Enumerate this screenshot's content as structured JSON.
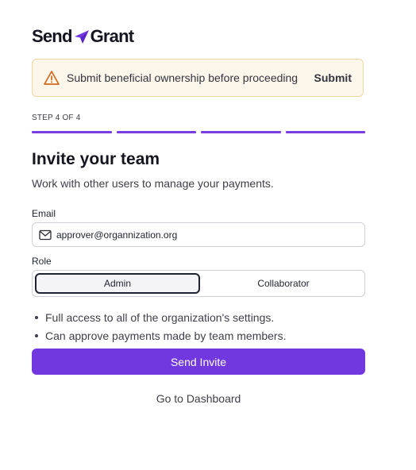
{
  "brand": {
    "name_left": "Send",
    "name_right": "Grant",
    "accent": "#7138e0"
  },
  "banner": {
    "icon": "warning-triangle-icon",
    "message": "Submit beneficial ownership before proceeding",
    "action": "Submit"
  },
  "progress": {
    "label": "STEP 4 OF 4",
    "current_step": 4,
    "total_steps": 4
  },
  "page": {
    "title": "Invite your team",
    "subtitle": "Work with other users to manage your payments."
  },
  "form": {
    "email_label": "Email",
    "email_value": "approver@organnization.org",
    "email_icon": "mail-icon",
    "role_label": "Role",
    "roles": [
      "Admin",
      "Collaborator"
    ],
    "selected_role": "Admin"
  },
  "permissions": [
    "Full access to all of the organization's settings.",
    "Can approve payments made by team members."
  ],
  "actions": {
    "send_invite": "Send Invite",
    "dashboard": "Go to Dashboard"
  }
}
